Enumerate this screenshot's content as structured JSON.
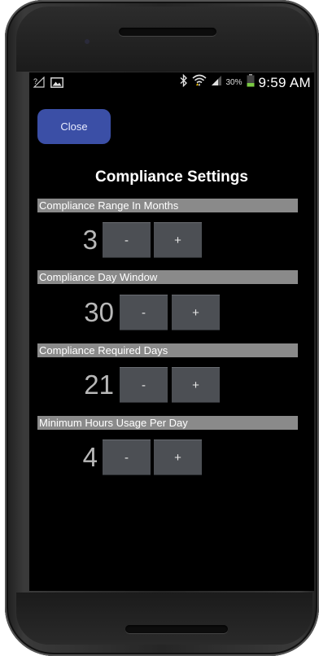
{
  "status_bar": {
    "signal_label": "?",
    "battery_percent": "30%",
    "time": "9:59 AM",
    "icons": [
      "signal-unknown-icon",
      "image-notification-icon",
      "bluetooth-icon",
      "wifi-icon",
      "cell-signal-icon",
      "battery-icon"
    ]
  },
  "close_button": {
    "label": "Close"
  },
  "page": {
    "title": "Compliance Settings"
  },
  "settings": [
    {
      "label": "Compliance Range In Months",
      "value": "3",
      "minus": "-",
      "plus": "+"
    },
    {
      "label": "Compliance Day Window",
      "value": "30",
      "minus": "-",
      "plus": "+"
    },
    {
      "label": "Compliance Required Days",
      "value": "21",
      "minus": "-",
      "plus": "+"
    },
    {
      "label": "Minimum Hours Usage Per Day",
      "value": "4",
      "minus": "-",
      "plus": "+"
    }
  ],
  "colors": {
    "close_button": "#3b4fa6",
    "section_bar": "#8a8a8a",
    "stepper_button": "#4c4f54",
    "value_text": "#b8b8b8",
    "battery_fill": "#7ac943"
  }
}
